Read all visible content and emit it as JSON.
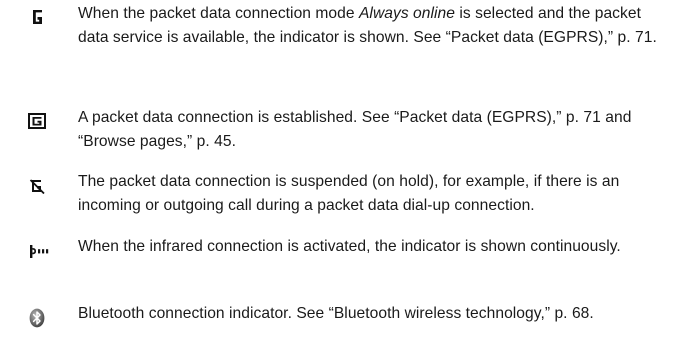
{
  "entries": [
    {
      "icon": "packet-data-available-icon",
      "text_before": "When the packet data connection mode ",
      "text_emphasis": "Always online",
      "text_after": " is selected and the packet data service is available, the indicator is shown. See “Packet data (EGPRS),” p. 71."
    },
    {
      "icon": "packet-data-established-icon",
      "text": "A packet data connection is established. See “Packet data (EGPRS),” p. 71 and “Browse pages,” p. 45."
    },
    {
      "icon": "packet-data-suspended-icon",
      "text": "The packet data connection is suspended (on hold), for example, if there is an incoming or outgoing call during a packet data dial-up connection."
    },
    {
      "icon": "infrared-icon",
      "text": "When the infrared connection is activated, the indicator is shown continuously."
    },
    {
      "icon": "bluetooth-icon",
      "text": "Bluetooth connection indicator. See “Bluetooth wireless technology,” p. 68."
    }
  ]
}
